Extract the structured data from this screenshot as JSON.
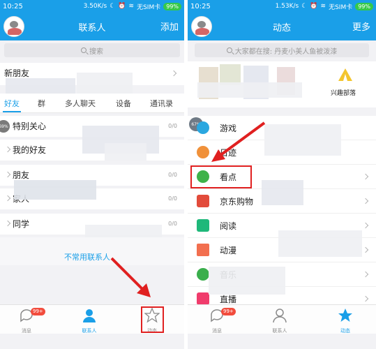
{
  "left": {
    "status": {
      "time": "10:25",
      "speed": "3.50K/s",
      "sim": "无SIM卡",
      "battery": "99%"
    },
    "title": "联系人",
    "action": "添加",
    "search_placeholder": "搜索",
    "new_friends": "新朋友",
    "tabs": [
      "好友",
      "群",
      "多人聊天",
      "设备",
      "通讯录"
    ],
    "groups": [
      {
        "name": "特别关心",
        "count": "0/0",
        "expanded": true
      },
      {
        "name": "我的好友",
        "count": "",
        "expanded": false
      },
      {
        "name": "朋友",
        "count": "0/0",
        "expanded": false
      },
      {
        "name": "家人",
        "count": "0/0",
        "expanded": false
      },
      {
        "name": "同学",
        "count": "0/0",
        "expanded": false
      }
    ],
    "badge_percent": "69%",
    "annotation": "不常用联系人",
    "nav": [
      {
        "label": "消息",
        "badge": "99+"
      },
      {
        "label": "联系人"
      },
      {
        "label": "动态"
      }
    ]
  },
  "right": {
    "status": {
      "time": "10:25",
      "speed": "1.53K/s",
      "sim": "无SIM卡",
      "battery": "99%"
    },
    "title": "动态",
    "action": "更多",
    "search_placeholder": "大家都在搜: 丹麦小美人鱼被泼漆",
    "quick_label": "兴趣部落",
    "badge_percent": "67%",
    "items": [
      {
        "label": "游戏",
        "color": "#2aa7e0"
      },
      {
        "label": "日迹",
        "color": "#f0913a"
      },
      {
        "label": "看点",
        "color": "#3fb24a"
      },
      {
        "label": "京东购物",
        "color": "#e24b3b"
      },
      {
        "label": "阅读",
        "color": "#1fb87a"
      },
      {
        "label": "动漫",
        "color": "#f26f4f"
      },
      {
        "label": "音乐",
        "color": "#3aae4c"
      },
      {
        "label": "直播",
        "color": "#f03c6c"
      }
    ],
    "nav": [
      {
        "label": "消息",
        "badge": "99+"
      },
      {
        "label": "联系人"
      },
      {
        "label": "动态"
      }
    ]
  },
  "colors": {
    "brand": "#1a9fe8",
    "highlight": "#e02020"
  }
}
